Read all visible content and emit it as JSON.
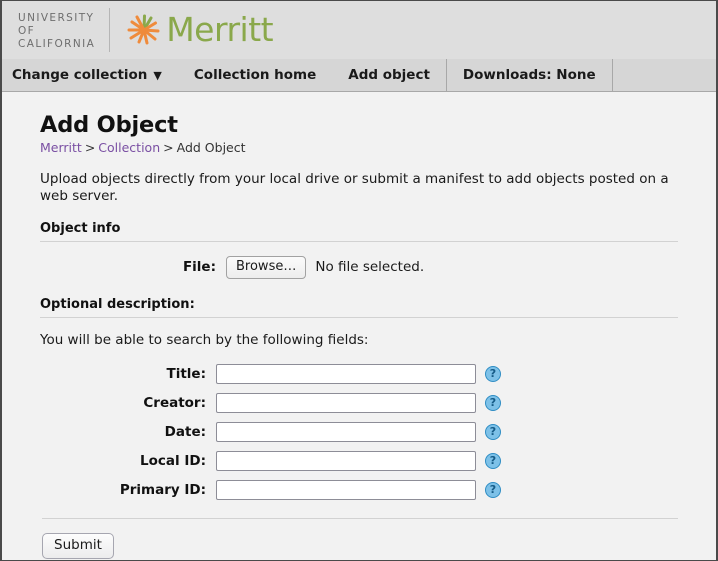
{
  "header": {
    "uc_logo_lines": [
      "UNIVERSITY",
      "OF",
      "CALIFORNIA"
    ],
    "brand_name": "Merritt",
    "brand_mark": "merritt-starburst-icon",
    "brand_green": "#8aa84b",
    "brand_orange": "#ef8b3c"
  },
  "nav": {
    "items": [
      {
        "label": "Change collection",
        "caret": "▼",
        "bordered": false
      },
      {
        "label": "Collection home",
        "caret": "",
        "bordered": false
      },
      {
        "label": "Add object",
        "caret": "",
        "bordered": false
      },
      {
        "label": "Downloads: None",
        "caret": "",
        "bordered": true
      }
    ]
  },
  "main": {
    "title": "Add Object",
    "breadcrumb": {
      "items": [
        "Merritt",
        "Collection",
        "Add Object"
      ],
      "separator": ">"
    },
    "intro": "Upload objects directly from your local drive or submit a manifest to add objects posted on a web server.",
    "object_info": {
      "heading": "Object info",
      "file_label": "File:",
      "browse_label": "Browse…",
      "file_status": "No file selected."
    },
    "optional_description": {
      "heading": "Optional description:",
      "note": "You will be able to search by the following fields:",
      "help_glyph": "?",
      "fields": [
        {
          "label": "Title:",
          "value": "",
          "placeholder": ""
        },
        {
          "label": "Creator:",
          "value": "",
          "placeholder": ""
        },
        {
          "label": "Date:",
          "value": "",
          "placeholder": ""
        },
        {
          "label": "Local ID:",
          "value": "",
          "placeholder": ""
        },
        {
          "label": "Primary ID:",
          "value": "",
          "placeholder": ""
        }
      ]
    },
    "submit_label": "Submit"
  }
}
